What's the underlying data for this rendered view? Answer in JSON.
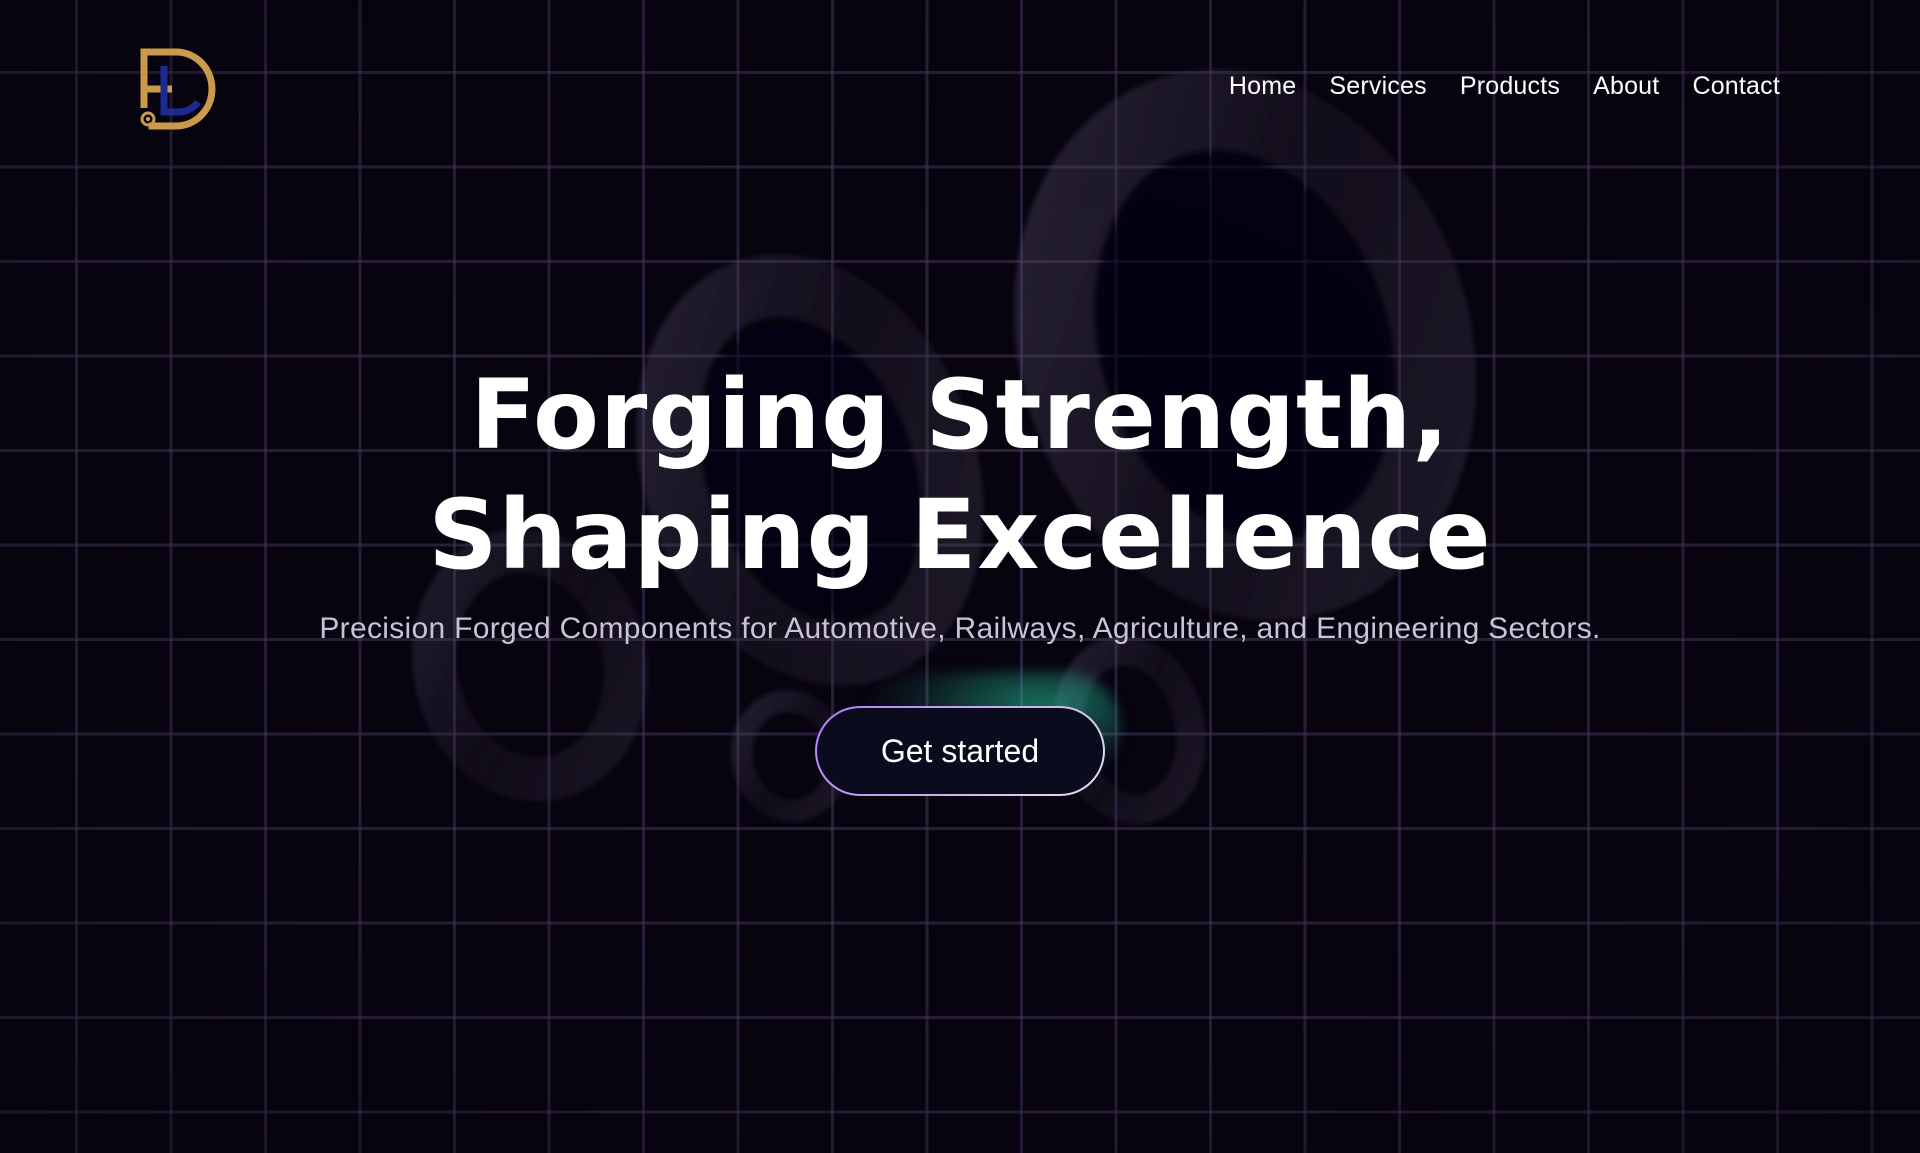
{
  "brand": {
    "logo_icon": "df-monogram-logo-icon",
    "colors": {
      "gold": "#c99a49",
      "navy": "#1c2b8f"
    }
  },
  "nav": {
    "items": [
      {
        "label": "Home"
      },
      {
        "label": "Services"
      },
      {
        "label": "Products"
      },
      {
        "label": "About"
      },
      {
        "label": "Contact"
      }
    ]
  },
  "hero": {
    "title_line1": "Forging Strength,",
    "title_line2": "Shaping Excellence",
    "subtitle": "Precision Forged Components for Automotive, Railways, Agriculture, and Engineering Sectors.",
    "cta_label": "Get started"
  },
  "theme": {
    "background": "#07030f",
    "grid_line": "#463c5f",
    "cta_border": "#b27cff",
    "cta_glow": "#28c8a0"
  }
}
